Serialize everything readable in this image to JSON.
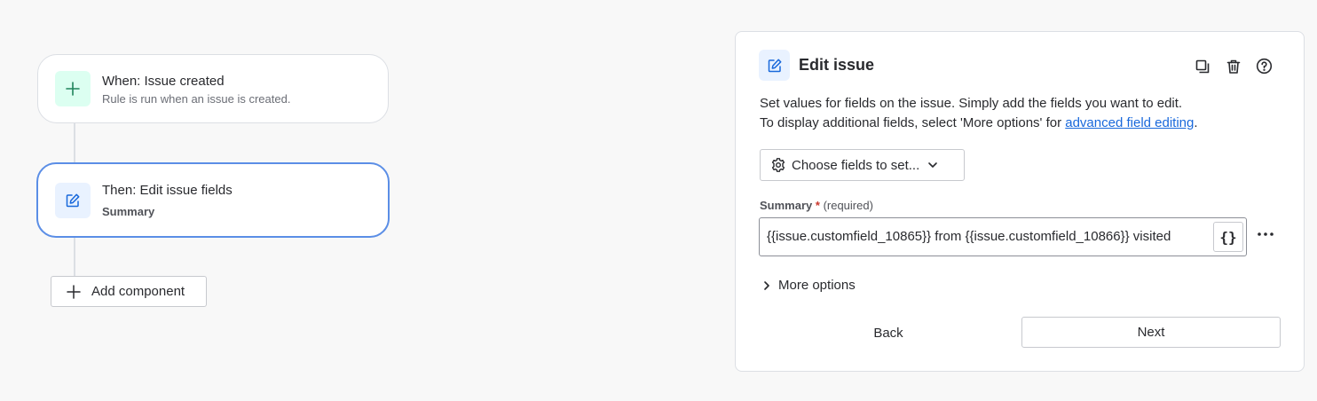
{
  "flow": {
    "trigger": {
      "icon": "plus-icon",
      "title": "When: Issue created",
      "subtitle": "Rule is run when an issue is created."
    },
    "action": {
      "icon": "edit-icon",
      "title": "Then: Edit issue fields",
      "subtitle": "Summary"
    },
    "add_component_label": "Add component"
  },
  "panel": {
    "title": "Edit issue",
    "icon": "edit-icon",
    "actions": [
      "copy-icon",
      "trash-icon",
      "help-icon"
    ],
    "description_line1": "Set values for fields on the issue. Simply add the fields you want to edit.",
    "description_line2_prefix": "To display additional fields, select 'More options' for ",
    "description_link": "advanced field editing",
    "description_line2_suffix": ".",
    "choose_fields_label": "Choose fields to set...",
    "field": {
      "label": "Summary",
      "required_marker": "*",
      "required_text": "(required)",
      "value": "{{issue.customfield_10865}} from {{issue.customfield_10866}} visited",
      "smart_value_button": "{}"
    },
    "more_options_label": "More options",
    "back_label": "Back",
    "next_label": "Next"
  },
  "colors": {
    "accent": "#5b8ee6",
    "link": "#1868db",
    "trigger_icon": "#1f845a",
    "action_icon": "#1868db",
    "required": "#c9372c"
  }
}
